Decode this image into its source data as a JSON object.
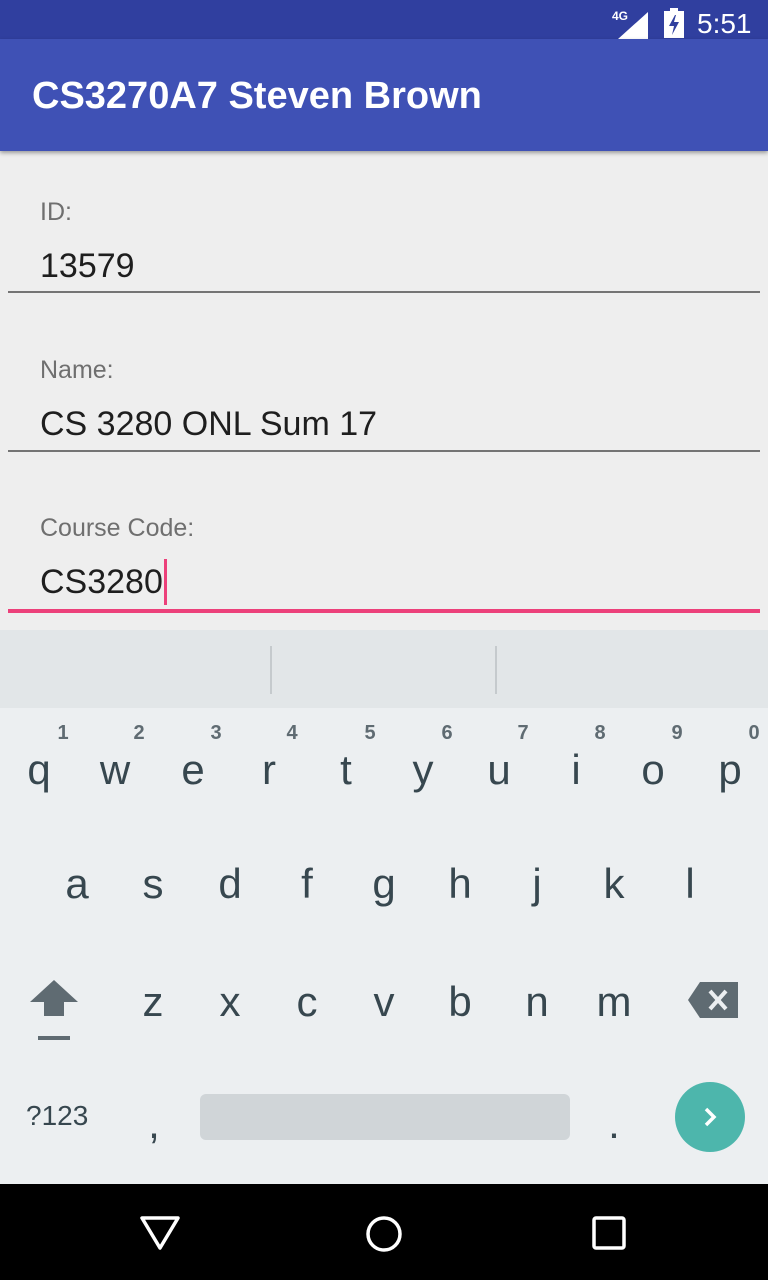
{
  "status_bar": {
    "network": "4G",
    "time": "5:51"
  },
  "app_bar": {
    "title": "CS3270A7 Steven Brown"
  },
  "form": {
    "id": {
      "label": "ID:",
      "value": "13579"
    },
    "name": {
      "label": "Name:",
      "value": "CS 3280 ONL Sum 17"
    },
    "course_code": {
      "label": "Course Code:",
      "value": "CS3280"
    }
  },
  "keyboard": {
    "row1": [
      "q",
      "w",
      "e",
      "r",
      "t",
      "y",
      "u",
      "i",
      "o",
      "p"
    ],
    "row1_hints": [
      "1",
      "2",
      "3",
      "4",
      "5",
      "6",
      "7",
      "8",
      "9",
      "0"
    ],
    "row2": [
      "a",
      "s",
      "d",
      "f",
      "g",
      "h",
      "j",
      "k",
      "l"
    ],
    "row3": [
      "z",
      "x",
      "c",
      "v",
      "b",
      "n",
      "m"
    ],
    "symbols_label": "?123",
    "comma": ",",
    "period": "."
  },
  "colors": {
    "status_bar": "#303f9f",
    "app_bar": "#3f51b5",
    "accent": "#ec407a",
    "enter": "#4db6ac"
  }
}
